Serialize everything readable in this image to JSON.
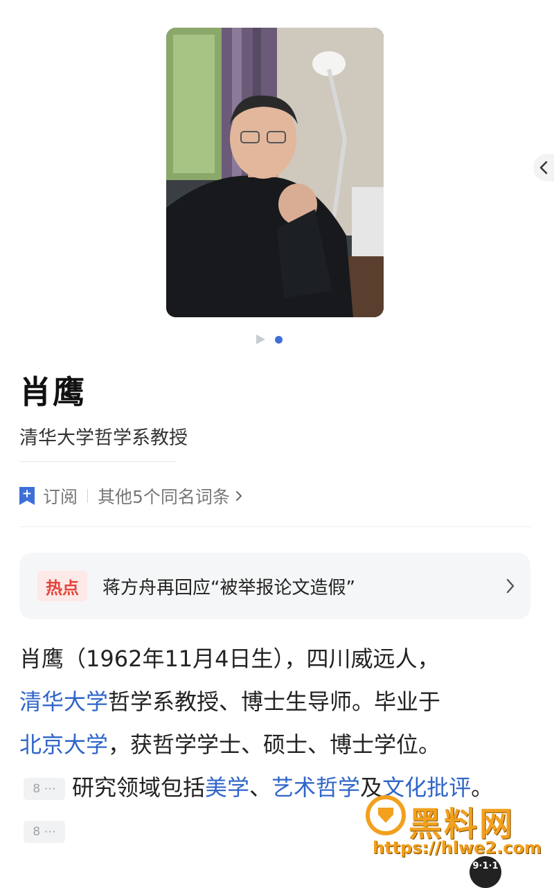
{
  "entry": {
    "name": "肖鹰",
    "description": "清华大学哲学系教授",
    "subscribe_label": "订阅",
    "same_name_label": "其他5个同名词条"
  },
  "hot": {
    "tag": "热点",
    "text": "蒋方舟再回应“被举报论文造假”"
  },
  "summary": {
    "part1": "肖鹰（1962年11月4日生），四川威远人，",
    "link_tsinghua": "清华大学",
    "part2": "哲学系教授、博士生导师。毕业于",
    "link_pku": "北京大学",
    "part3": "，获哲学学士、硕士、博士学位。",
    "cite_a": "8",
    "part4": "研究领域包括",
    "link_aesthetics": "美学",
    "part5": "、",
    "link_art_philosophy": "艺术哲学",
    "part6": "及",
    "link_cultural_criticism": "文化批评",
    "part7": "。",
    "cite_b": "8"
  },
  "watermark": {
    "brand": "黑料网",
    "url": "https://hlwe2.com",
    "badge": "9·1·1"
  },
  "icons": {
    "gallery_prev": "chevron-left-icon",
    "gallery_play": "play-icon",
    "subscribe": "bookmark-plus-icon",
    "same_name": "chevron-right-icon",
    "hot": "chevron-right-icon",
    "citation": "ellipsis-icon"
  },
  "colors": {
    "accent": "#3d6fd9",
    "link": "#2f65c9",
    "hot_tag_text": "#e4433b",
    "hot_tag_bg": "#fde9e7"
  }
}
